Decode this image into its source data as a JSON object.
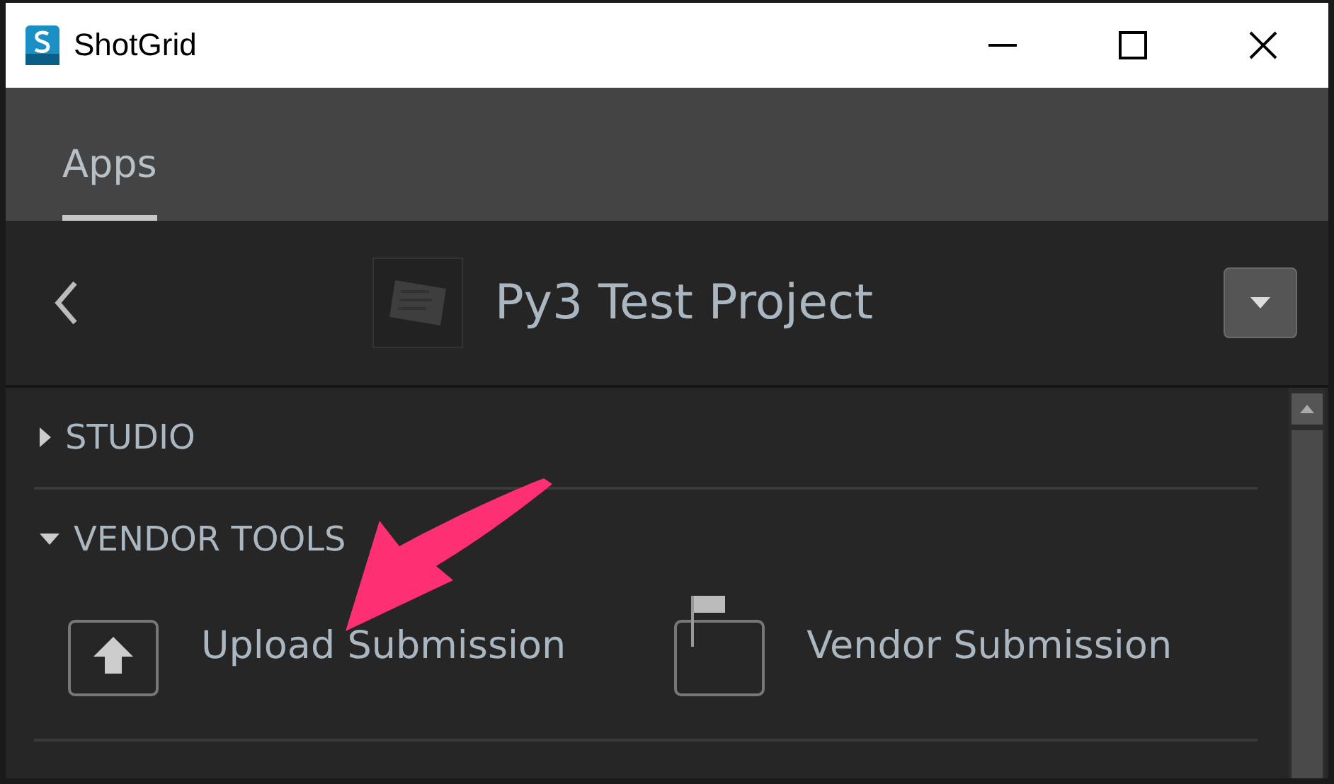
{
  "window": {
    "title": "ShotGrid"
  },
  "tabs": [
    {
      "label": "Apps",
      "selected": true
    }
  ],
  "header": {
    "project": "Py3 Test Project"
  },
  "sections": [
    {
      "label": "STUDIO",
      "expanded": false
    },
    {
      "label": "VENDOR TOOLS",
      "expanded": true,
      "apps": [
        {
          "label": "Upload Submission",
          "kind": "upload"
        },
        {
          "label": "Vendor Submission",
          "kind": "flag"
        }
      ]
    }
  ]
}
